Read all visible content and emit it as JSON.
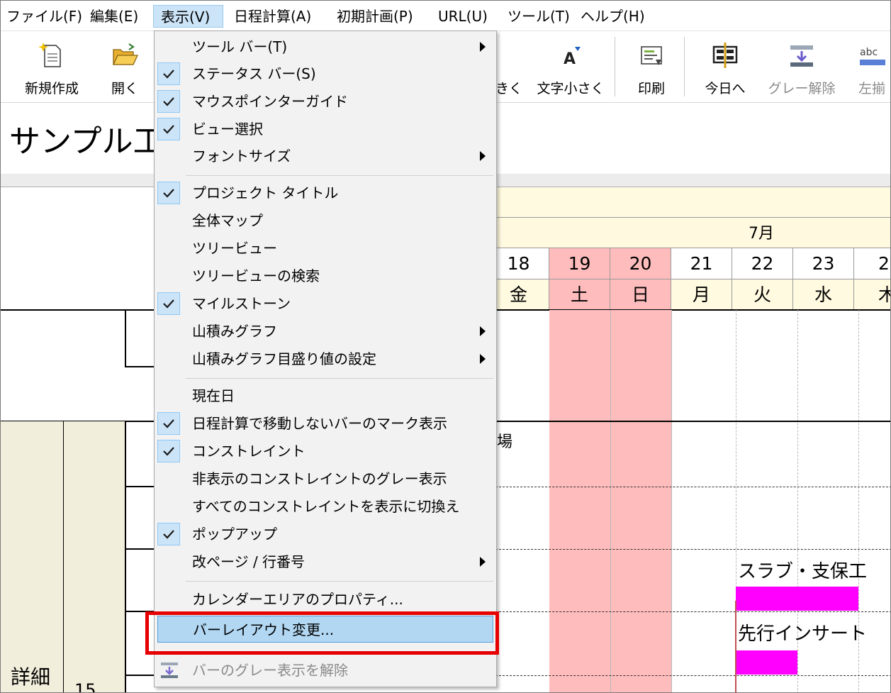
{
  "menubar": {
    "items": [
      "ファイル(F)",
      "編集(E)",
      "表示(V)",
      "日程計算(A)",
      "初期計画(P)",
      "URL(U)",
      "ツール(T)",
      "ヘルプ(H)"
    ]
  },
  "toolbar": {
    "new": "新規作成",
    "open": "開く",
    "larger_partial": "きく",
    "smaller": "文字小さく",
    "print": "印刷",
    "today": "今日へ",
    "ungray": "グレー解除",
    "align_left": "左揃"
  },
  "project_title": "サンプル工",
  "calendar": {
    "month": "7月",
    "days": [
      "18",
      "19",
      "20",
      "21",
      "22",
      "23",
      "2"
    ],
    "weekdays": [
      "金",
      "土",
      "日",
      "月",
      "火",
      "水",
      "木"
    ]
  },
  "gantt": {
    "task1": "スラブ・支保工",
    "task2": "先行インサート",
    "cut_char": "場"
  },
  "left": {
    "detail": "詳細",
    "number": "15"
  },
  "dropdown": {
    "items": [
      {
        "label": "ツール バー(T)",
        "checked": false,
        "submenu": true
      },
      {
        "label": "ステータス バー(S)",
        "checked": true,
        "submenu": false
      },
      {
        "label": "マウスポインターガイド",
        "checked": true,
        "submenu": false
      },
      {
        "label": "ビュー選択",
        "checked": true,
        "submenu": false
      },
      {
        "label": "フォントサイズ",
        "checked": false,
        "submenu": true
      },
      {
        "label": "プロジェクト タイトル",
        "checked": true,
        "submenu": false
      },
      {
        "label": "全体マップ",
        "checked": false,
        "submenu": false
      },
      {
        "label": "ツリービュー",
        "checked": false,
        "submenu": false
      },
      {
        "label": "ツリービューの検索",
        "checked": false,
        "submenu": false
      },
      {
        "label": "マイルストーン",
        "checked": true,
        "submenu": false
      },
      {
        "label": "山積みグラフ",
        "checked": false,
        "submenu": true
      },
      {
        "label": "山積みグラフ目盛り値の設定",
        "checked": false,
        "submenu": true
      },
      {
        "label": "現在日",
        "checked": false,
        "submenu": false
      },
      {
        "label": "日程計算で移動しないバーのマーク表示",
        "checked": true,
        "submenu": false
      },
      {
        "label": "コンストレイント",
        "checked": true,
        "submenu": false
      },
      {
        "label": "非表示のコンストレイントのグレー表示",
        "checked": false,
        "submenu": false
      },
      {
        "label": "すべてのコンストレイントを表示に切換え",
        "checked": false,
        "submenu": false
      },
      {
        "label": "ポップアップ",
        "checked": true,
        "submenu": false
      },
      {
        "label": "改ページ / 行番号",
        "checked": false,
        "submenu": true
      },
      {
        "label": "カレンダーエリアのプロパティ...",
        "checked": false,
        "submenu": false
      },
      {
        "label": "バーレイアウト変更...",
        "checked": false,
        "submenu": false,
        "highlighted": true
      },
      {
        "label": "バーのグレー表示を解除",
        "checked": false,
        "submenu": false,
        "disabled": true
      }
    ]
  },
  "colors": {
    "menu_highlight": "#b2d7f3",
    "check_bg": "#cce4f7",
    "weekend": "#ffbcbc",
    "bar": "#ff00ff",
    "red_box": "#e60000"
  }
}
